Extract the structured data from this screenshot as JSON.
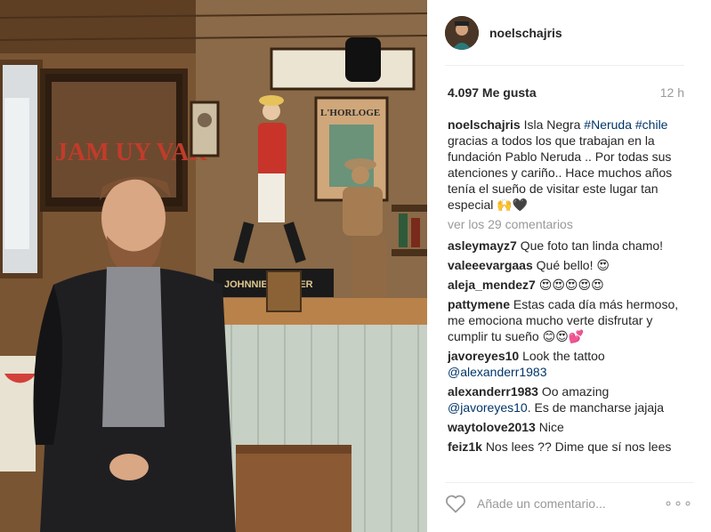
{
  "post": {
    "username": "noelschajris",
    "likes": "4.097 Me gusta",
    "time": "12 h"
  },
  "caption": {
    "user": "noelschajris",
    "text_before": "Isla Negra ",
    "tag1": "#Neruda",
    "tag2": "#chile",
    "text_after": " gracias a todos los que trabajan en la fundación Pablo Neruda .. Por todas sus atenciones y cariño.. Hace muchos años tenía el sueño de visitar este lugar tan especial 🙌🖤"
  },
  "view_all": "ver los 29 comentarios",
  "comments": [
    {
      "user": "asleymayz7",
      "text": "Que foto tan linda chamo!"
    },
    {
      "user": "valeeevargaas",
      "text": "Qué bello! 😍"
    },
    {
      "user": "aleja_mendez7",
      "text": "😍😍😍😍😍"
    },
    {
      "user": "pattymene",
      "text": "Estas cada día más hermoso, me emociona mucho verte disfrutar y cumplir tu sueño 😊😍💕"
    }
  ],
  "comment_javo": {
    "user": "javoreyes10",
    "text": "Look the tattoo",
    "mention": "@alexanderr1983"
  },
  "comment_alex": {
    "user": "alexanderr1983",
    "text": "Oo amazing",
    "mention": "@javoreyes10",
    "text_after": ". Es de mancharse jajaja"
  },
  "comment_way": {
    "user": "waytolove2013",
    "text": "Nice"
  },
  "comment_feiz": {
    "user": "feiz1k",
    "text": "Nos lees ?? Dime que sí nos lees"
  },
  "input": {
    "placeholder": "Añade un comentario..."
  },
  "more_label": "∘∘∘",
  "photo_signs": {
    "sign1": "L'HORLOGE",
    "sign2": "JAM UY VAR",
    "sign3": "JOHNNIE WALKER"
  },
  "icons": {
    "heart": "heart-outline-icon",
    "more": "more-options-icon"
  }
}
